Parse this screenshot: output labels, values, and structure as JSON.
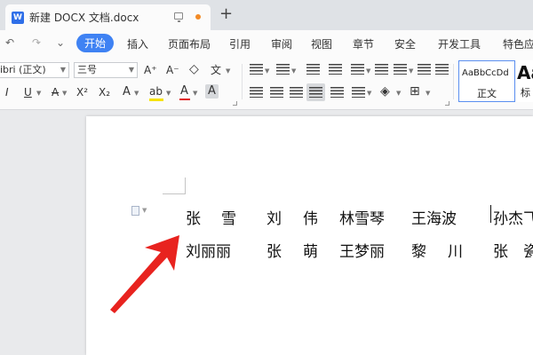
{
  "window": {
    "doc_title": "新建 DOCX 文档.docx",
    "new_tab": "+",
    "logo_letter": "W"
  },
  "menu": {
    "undo": "↶",
    "redo": "↷",
    "quick_dropdown": "⌄",
    "items": [
      "开始",
      "插入",
      "页面布局",
      "引用",
      "审阅",
      "视图",
      "章节",
      "安全",
      "开发工具",
      "特色应用"
    ]
  },
  "toolbar": {
    "font_name": "ibri (正文)",
    "font_size": "三号",
    "grow_font": "A⁺",
    "shrink_font": "A⁻",
    "clear_format": "◇",
    "pinyin": "文",
    "italic": "I",
    "underline": "U",
    "strike": "A",
    "superscript": "X²",
    "subscript": "X₂",
    "text_effect": "A",
    "highlight": "ab",
    "font_color": "A",
    "char_shading": "A",
    "styles": {
      "sample_normal": "AaBbCcDd",
      "normal_label": "正文",
      "sample_heading": "Aa",
      "heading_label": "标"
    },
    "colors": {
      "accent": "#3f82f3",
      "font_red": "#e02020",
      "highlight_yellow": "#f6e200"
    }
  },
  "document": {
    "line1": [
      "张",
      "雪",
      "刘",
      "伟",
      "林雪琴",
      "王海波",
      "孙杰",
      "飞"
    ],
    "line2": [
      "刘丽丽",
      "张",
      "萌",
      "王梦丽",
      "黎",
      "川",
      "张",
      "瓷"
    ]
  }
}
